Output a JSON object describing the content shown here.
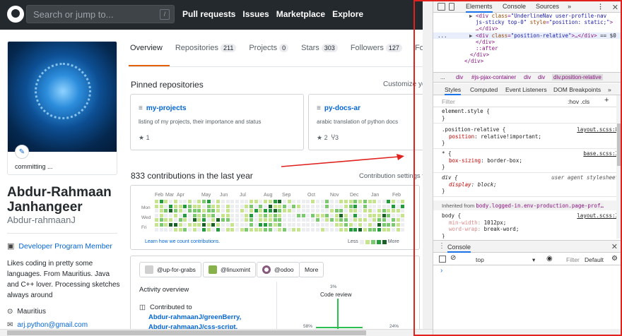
{
  "header": {
    "search_placeholder": "Search or jump to...",
    "search_key": "/",
    "nav": [
      "Pull requests",
      "Issues",
      "Marketplace",
      "Explore"
    ]
  },
  "profile": {
    "status": "committing ...",
    "name": "Abdur-Rahmaan Janhangeer",
    "login": "Abdur-rahmaanJ",
    "badge": "Developer Program Member",
    "bio": "Likes coding in pretty some languages. From Mauritius. Java and C++ lover. Processing sketches always around",
    "location": "Mauritius",
    "email": "arj.python@gmail.com"
  },
  "tabs": [
    {
      "label": "Overview",
      "count": ""
    },
    {
      "label": "Repositories",
      "count": "211"
    },
    {
      "label": "Projects",
      "count": "0"
    },
    {
      "label": "Stars",
      "count": "303"
    },
    {
      "label": "Followers",
      "count": "127"
    },
    {
      "label": "Following",
      "count": ""
    }
  ],
  "pinned": {
    "title": "Pinned repositories",
    "customize": "Customize your pins",
    "repos": [
      {
        "name": "my-projects",
        "desc": "listing of my projects, their importance and status",
        "stars": "1",
        "forks": ""
      },
      {
        "name": "py-docs-ar",
        "desc": "arabic translation of python docs",
        "stars": "2",
        "forks": "3"
      }
    ]
  },
  "contributions": {
    "title": "833 contributions in the last year",
    "settings": "Contribution settings",
    "months": [
      "Feb",
      "Mar",
      "Apr",
      "May",
      "Jun",
      "Jul",
      "Aug",
      "Sep",
      "Oct",
      "Nov",
      "Dec",
      "Jan",
      "Feb"
    ],
    "days": [
      "Mon",
      "Wed",
      "Fri"
    ],
    "learn": "Learn how we count contributions.",
    "less": "Less",
    "more": "More",
    "colors": [
      "#ebedf0",
      "#c6e48b",
      "#7bc96f",
      "#239a3b",
      "#196127"
    ]
  },
  "orgs": [
    "@up-for-grabs",
    "@linuxmint",
    "@odoo"
  ],
  "orgs_more": "More",
  "activity": {
    "title": "Activity overview",
    "contributed": "Contributed to",
    "links": [
      "Abdur-rahmaanJ/greenBerry,",
      "Abdur-rahmaanJ/css-script,"
    ],
    "code_review_pct": "3%",
    "code_review": "Code review",
    "left_pct": "58%",
    "right_pct": "24%"
  },
  "devtools": {
    "tabs": [
      "Elements",
      "Console",
      "Sources",
      "»"
    ],
    "dom_lines": [
      {
        "indent": 7,
        "parts": [
          [
            "tg",
            "<div "
          ],
          [
            "at",
            "class"
          ],
          [
            "tg",
            "="
          ],
          [
            "av",
            "\"UnderlineNav user-profile-nav"
          ]
        ]
      },
      {
        "indent": 7,
        "parts": [
          [
            "av",
            "js-sticky top-0\" "
          ],
          [
            "at",
            "style"
          ],
          [
            "tg",
            "="
          ],
          [
            "av",
            "\"position: static;\""
          ],
          [
            "tg",
            ">"
          ]
        ]
      },
      {
        "indent": 7,
        "parts": [
          [
            "tg",
            "…</div>"
          ]
        ]
      },
      {
        "indent": 7,
        "parts": [
          [
            "tg",
            "<div "
          ],
          [
            "at",
            "class"
          ],
          [
            "tg",
            "="
          ],
          [
            "av",
            "\"position-relative\""
          ],
          [
            "tg",
            ">…</div>"
          ],
          [
            "pv",
            " == $0"
          ]
        ]
      },
      {
        "indent": 7,
        "parts": [
          [
            "tg",
            "</div>"
          ]
        ]
      },
      {
        "indent": 7,
        "parts": [
          [
            "tg",
            "::after"
          ]
        ]
      },
      {
        "indent": 6,
        "parts": [
          [
            "tg",
            "</div>"
          ]
        ]
      },
      {
        "indent": 5,
        "parts": [
          [
            "tg",
            "</div>"
          ]
        ]
      }
    ],
    "crumbs": [
      "...",
      "div",
      "#js-pjax-container",
      "div",
      "div",
      "div.position-relative"
    ],
    "style_tabs": [
      "Styles",
      "Computed",
      "Event Listeners",
      "DOM Breakpoints",
      "»"
    ],
    "filter": "Filter",
    "hov": ":hov  .cls",
    "plus": "+",
    "rules": [
      {
        "selector": "element.style {",
        "src": "",
        "props": []
      },
      {
        "selector": ".position-relative {",
        "src": "layout.scss:8",
        "props": [
          {
            "n": "position",
            "v": "relative!important;"
          }
        ]
      },
      {
        "selector": "* {",
        "src": "base.scss:3",
        "props": [
          {
            "n": "box-sizing",
            "v": "border-box;"
          }
        ]
      },
      {
        "selector": "div {",
        "src": "user agent stylesheet",
        "props": [
          {
            "n": "display",
            "v": "block;"
          }
        ]
      }
    ],
    "inherited_label": "Inherited from",
    "inherited_sel": "body.logged-in.env-production.page-prof…",
    "body_rule": {
      "selector": "body {",
      "src": "layout.scss:3",
      "props": [
        {
          "n": "min-width",
          "v": "1012px;"
        },
        {
          "n": "word-wrap",
          "v": "break-word;"
        }
      ]
    },
    "console_tab": "Console",
    "context": "top",
    "filter2": "Filter",
    "levels": "Default",
    "prompt": "›"
  }
}
